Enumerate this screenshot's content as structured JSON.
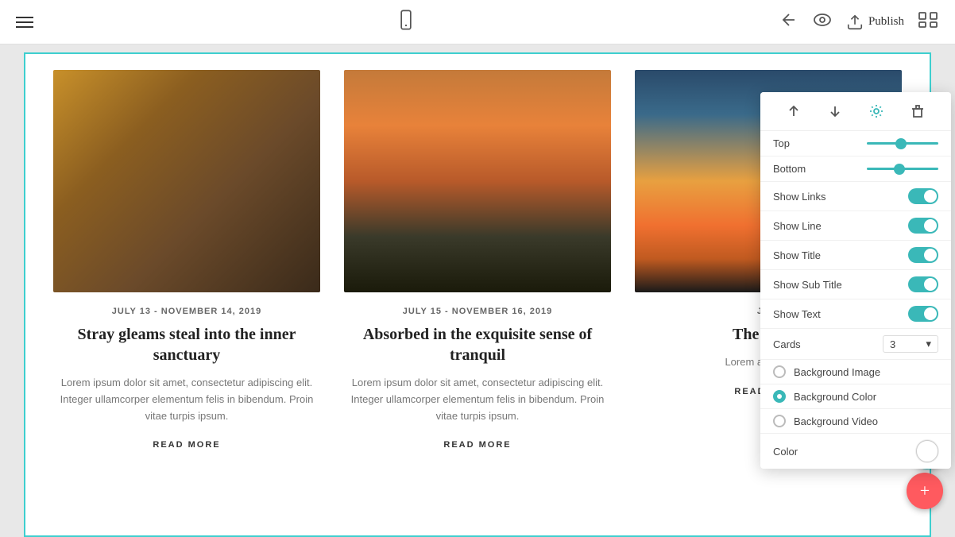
{
  "topbar": {
    "publish_label": "Publish"
  },
  "cards": [
    {
      "date": "JULY 13 - NOVEMBER 14, 2019",
      "title": "Stray gleams steal into the inner sanctuary",
      "text": "Lorem ipsum dolor sit amet, consectetur adipiscing elit. Integer ullamcorper elementum felis in bibendum. Proin vitae turpis ipsum.",
      "read_more": "READ MORE",
      "image_type": "laptop"
    },
    {
      "date": "JULY 15 - NOVEMBER 16, 2019",
      "title": "Absorbed in the exquisite sense of tranquil",
      "text": "Lorem ipsum dolor sit amet, consectetur adipiscing elit. Integer ullamcorper elementum felis in bibendum. Proin vitae turpis ipsum.",
      "read_more": "READ MORE",
      "image_type": "bikes"
    },
    {
      "date": "JU...",
      "title": "The m...ne",
      "text": "Lorem adipiscing...",
      "read_more": "READ MORE",
      "image_type": "sunset"
    }
  ],
  "popup": {
    "toolbar": {
      "up_label": "↑",
      "down_label": "↓",
      "settings_label": "⚙",
      "delete_label": "🗑"
    },
    "top_label": "Top",
    "bottom_label": "Bottom",
    "show_links_label": "Show Links",
    "show_line_label": "Show Line",
    "show_title_label": "Show Title",
    "show_sub_title_label": "Show Sub Title",
    "show_text_label": "Show Text",
    "cards_label": "Cards",
    "cards_value": "3",
    "background_image_label": "Background Image",
    "background_color_label": "Background Color",
    "background_video_label": "Background Video",
    "color_label": "Color"
  },
  "fabs": {
    "edit_icon": "pencil",
    "add_icon": "plus"
  }
}
